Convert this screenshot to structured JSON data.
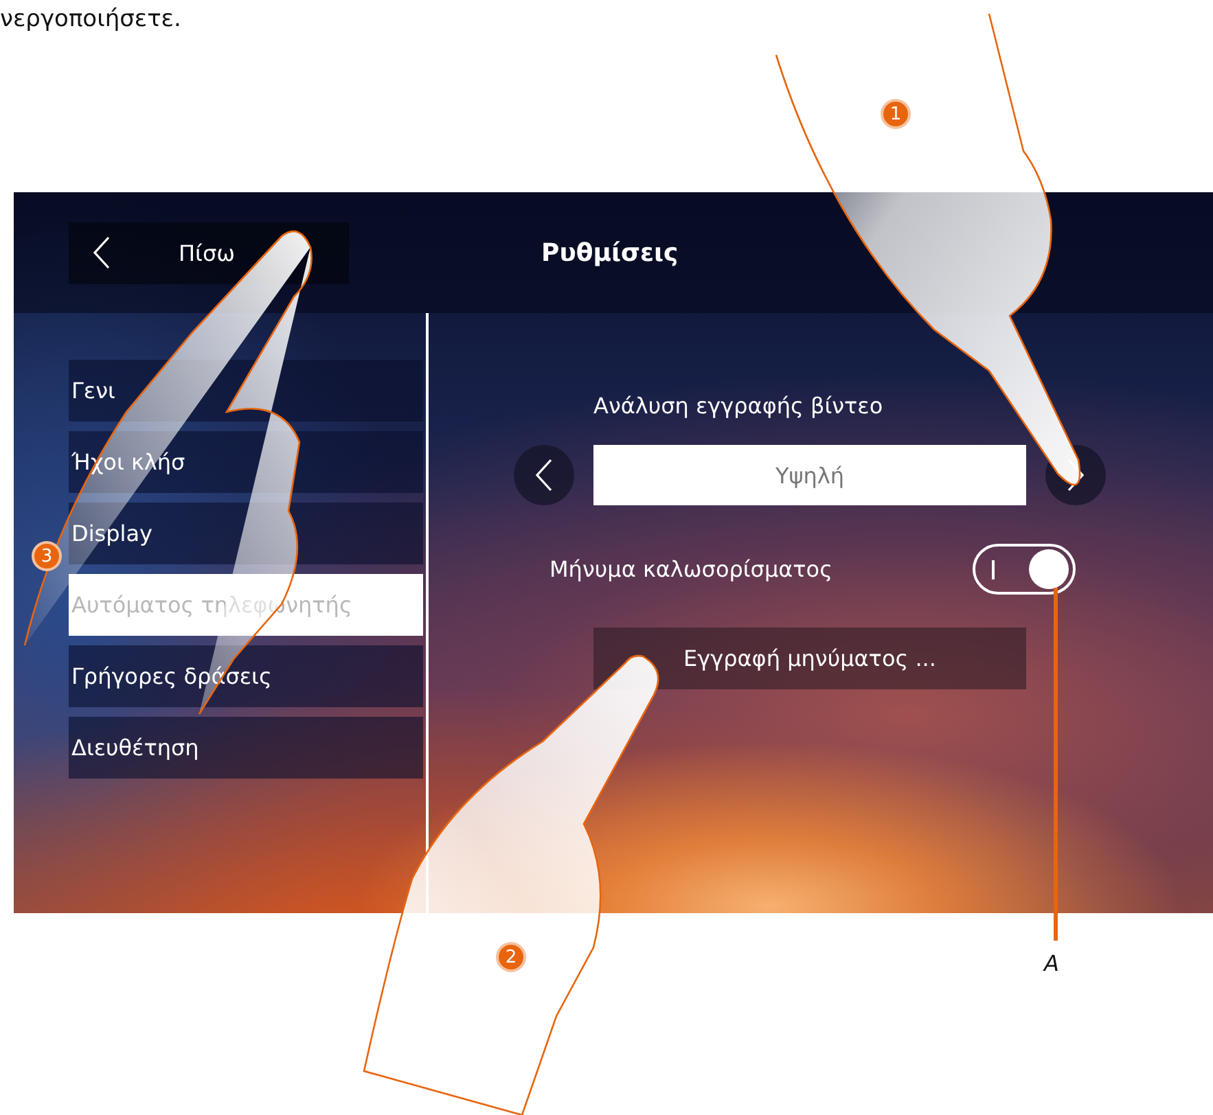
{
  "intro_text": "νεργοποιήσετε.",
  "screen": {
    "back_button": {
      "label": "Πίσω"
    },
    "title": "Ρυθμίσεις",
    "menu": [
      {
        "label": "Γενι",
        "selected": false
      },
      {
        "label": "Ήχοι κλήσ",
        "selected": false
      },
      {
        "label": "Display",
        "selected": false
      },
      {
        "label": "Αυτόματος τηλεφωνητής",
        "selected": true
      },
      {
        "label": "Γρήγορες δράσεις",
        "selected": false
      },
      {
        "label": "Διευθέτηση",
        "selected": false
      }
    ],
    "video_resolution": {
      "label": "Ανάλυση εγγραφής βίντεο",
      "value": "Υψηλή"
    },
    "welcome_message": {
      "label": "Μήνυμα καλωσορίσματος",
      "on": true
    },
    "record_button": {
      "label": "Εγγραφή μηνύματος ..."
    }
  },
  "steps": [
    {
      "number": "1"
    },
    {
      "number": "2"
    },
    {
      "number": "3"
    }
  ],
  "callouts": [
    {
      "label": "A"
    }
  ]
}
